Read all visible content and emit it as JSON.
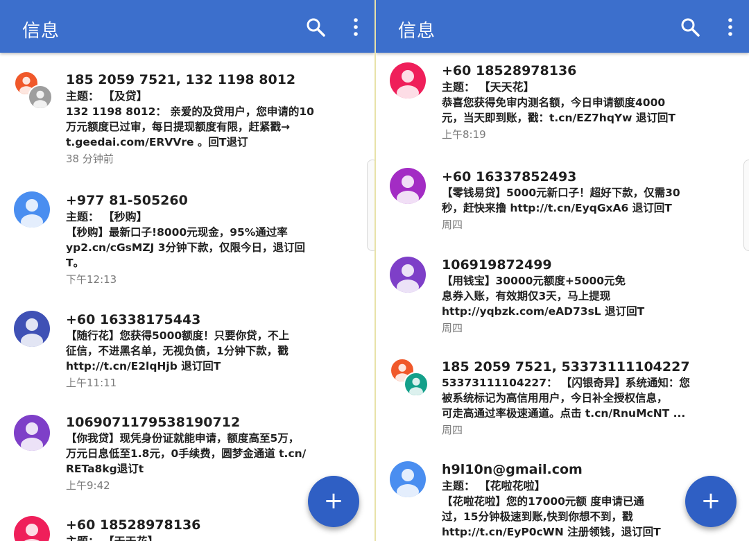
{
  "colors": {
    "app_bar": "#3c6fcc",
    "fab": "#2f5fc4",
    "timestamp": "#7a7a7a",
    "avatar_orange": "#f0582a",
    "avatar_gray": "#9e9e9e",
    "avatar_blue": "#4a8ef0",
    "avatar_indigo": "#3f51b5",
    "avatar_purple": "#7e3fc8",
    "avatar_pink": "#ef1f5a",
    "avatar_magenta": "#a32cc4",
    "avatar_teal": "#14a08a"
  },
  "left": {
    "title": "信息",
    "icons": [
      "search-icon",
      "more-vert-icon"
    ],
    "fab_label": "+",
    "messages": [
      {
        "sender": "185 2059 7521, 132 1198 8012",
        "subject": "主题：  【及贷】",
        "body_lines": [
          "132 1198 8012： 亲爱的及贷用户，您申请的10",
          "万元额度已过审，每日提现额度有限，赶紧戳→",
          "t.geedai.com/ERVVre 。回T退订"
        ],
        "time": "38 分钟前"
      },
      {
        "sender": "+977 81-505260",
        "subject": "主题：  【秒购】",
        "body_lines": [
          "【秒购】最新口子!8000元现金，95%通过率",
          "yp2.cn/cGsMZJ 3分钟下款，仅限今日，退订回",
          "T。"
        ],
        "time": "下午12:13"
      },
      {
        "sender": "+60 16338175443",
        "subject": "",
        "body_lines": [
          "【随行花】您获得5000额度！只要你贷，不上",
          "征信，不进黑名单，无视负债，1分钟下款，戳",
          "http://t.cn/E2lqHjb 退订回T"
        ],
        "time": "上午11:11"
      },
      {
        "sender": "1069071179538190712",
        "subject": "",
        "body_lines": [
          "【你我贷】现凭身份证就能申请，额度高至5万，",
          "万元日息低至1.8元，0手续费，圆梦金通道 t.cn/",
          "RETa8kg退订t"
        ],
        "time": "上午9:42"
      },
      {
        "sender": "+60 18528978136",
        "subject": "主题：  【天天花】",
        "body_lines": [],
        "time": ""
      }
    ]
  },
  "right": {
    "title": "信息",
    "icons": [
      "search-icon",
      "more-vert-icon"
    ],
    "fab_label": "+",
    "messages": [
      {
        "sender": "+60 18528978136",
        "subject": "主题：  【天天花】",
        "body_lines": [
          "恭喜您获得免审内测名额，今日申请额度4000",
          "元，当天即到账，戳：t.cn/EZ7hqYw 退订回T"
        ],
        "time": "上午8:19"
      },
      {
        "sender": "+60 16337852493",
        "subject": "",
        "body_lines": [
          "【零钱易贷】5000元新口子！超好下款，仅需30",
          "秒，赶快来撸 http://t.cn/EyqGxA6 退订回T"
        ],
        "time": "周四"
      },
      {
        "sender": "106919872499",
        "subject": "",
        "body_lines": [
          "【用钱宝】30000元额度+5000元免",
          "息券入账，有效期仅3天，马上提现",
          "http://yqbzk.com/eAD73sL 退订回T"
        ],
        "time": "周四"
      },
      {
        "sender": "185 2059 7521, 53373111104227",
        "subject": "",
        "body_lines": [
          "53373111104227： 【闪银奇异】系统通知：您",
          "被系统标记为高信用用户，今日补全授权信息，",
          "可走高通过率极速通道。点击  t.cn/RnuMcNT ..."
        ],
        "time": "周四"
      },
      {
        "sender": "h9l10n@gmail.com",
        "subject": "主题：  【花啦花啦】",
        "body_lines": [
          "【花啦花啦】您的17000元额 度申请已通",
          "过，15分钟极速到账,快到你想不到，戳",
          "http://t.cn/EyP0cWN 注册领钱，退订回T"
        ],
        "time": ""
      }
    ]
  }
}
